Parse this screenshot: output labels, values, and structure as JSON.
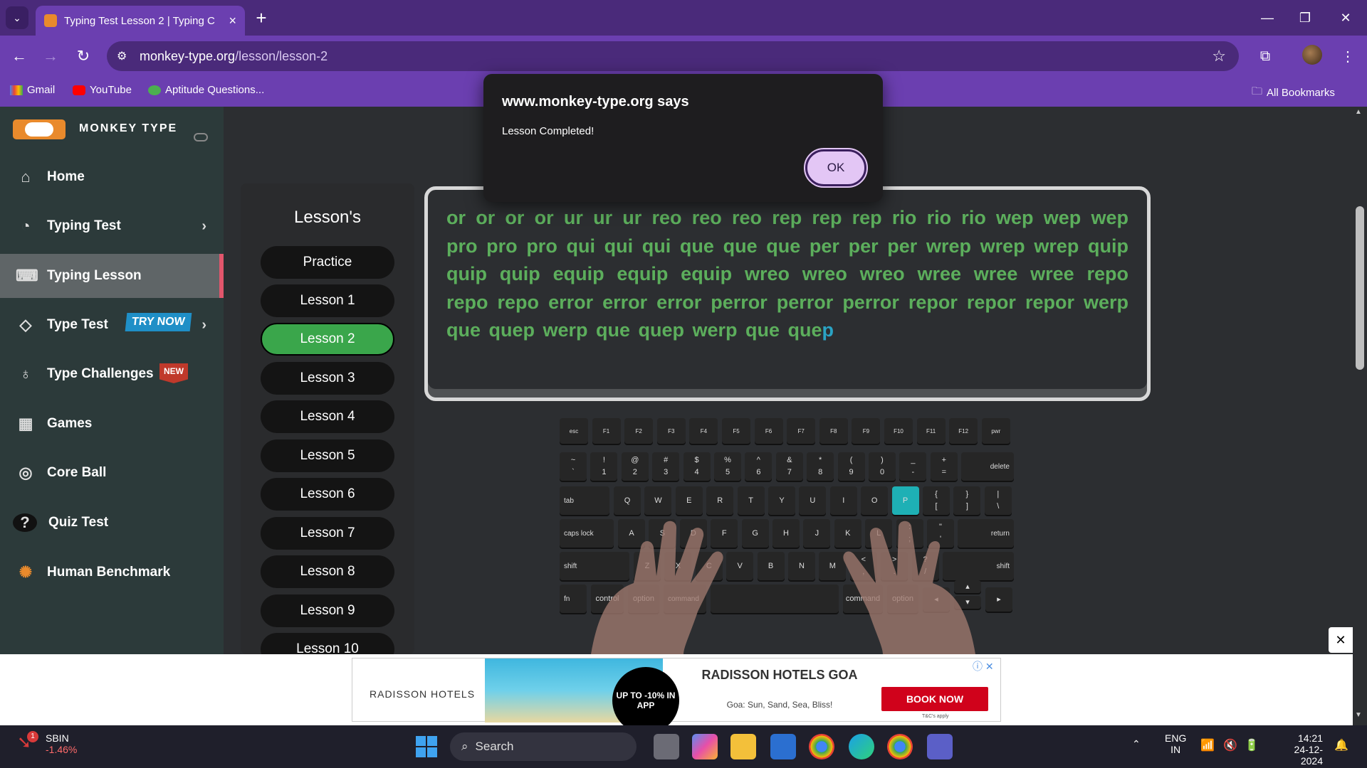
{
  "browser": {
    "tab_title": "Typing Test Lesson 2 | Typing C",
    "url_host": "monkey-type.org",
    "url_path": "/lesson/lesson-2",
    "bookmarks": [
      "Gmail",
      "YouTube",
      "Aptitude Questions..."
    ],
    "all_bookmarks": "All Bookmarks"
  },
  "sidebar": {
    "brand": "MONKEY TYPE",
    "items": [
      {
        "label": "Home",
        "icon": "home-icon"
      },
      {
        "label": "Typing Test",
        "icon": "github-icon"
      },
      {
        "label": "Typing Lesson",
        "icon": "keyboard-icon"
      },
      {
        "label": "Type Test",
        "icon": "gitlab-icon",
        "badge": "TRY NOW"
      },
      {
        "label": "Type Challenges",
        "icon": "award-icon",
        "badge": "NEW"
      },
      {
        "label": "Games",
        "icon": "grid-icon"
      },
      {
        "label": "Core Ball",
        "icon": "target-icon"
      },
      {
        "label": "Quiz Test",
        "icon": "quiz-icon"
      },
      {
        "label": "Human Benchmark",
        "icon": "brain-icon"
      }
    ]
  },
  "lessons": {
    "title": "Lesson's",
    "items": [
      "Practice",
      "Lesson 1",
      "Lesson 2",
      "Lesson 3",
      "Lesson 4",
      "Lesson 5",
      "Lesson 6",
      "Lesson 7",
      "Lesson 8",
      "Lesson 9",
      "Lesson 10"
    ],
    "active": "Lesson 2"
  },
  "typing": {
    "typed_text": "or or or or ur ur ur reo reo reo rep rep rep rio rio rio wep wep wep pro pro pro qui qui qui que que que per per per wrep wrep wrep quip quip quip equip equip equip wreo wreo wreo wree wree wree repo repo repo error error error perror perror perror repor repor repor werp que quep werp que quep werp que que",
    "cursor_char": "p"
  },
  "keyboard": {
    "fn_row": [
      "esc",
      "F1",
      "F2",
      "F3",
      "F4",
      "F5",
      "F6",
      "F7",
      "F8",
      "F9",
      "F10",
      "F11",
      "F12",
      "pwr"
    ],
    "num_row": [
      [
        "~",
        "`"
      ],
      [
        "!",
        "1"
      ],
      [
        "@",
        "2"
      ],
      [
        "#",
        "3"
      ],
      [
        "$",
        "4"
      ],
      [
        "%",
        "5"
      ],
      [
        "^",
        "6"
      ],
      [
        "&",
        "7"
      ],
      [
        "*",
        "8"
      ],
      [
        "(",
        "9"
      ],
      [
        ")",
        "0"
      ],
      [
        "_",
        "-"
      ],
      [
        "+",
        "="
      ]
    ],
    "delete": "delete",
    "tab": "tab",
    "q_row": [
      "Q",
      "W",
      "E",
      "R",
      "T",
      "Y",
      "U",
      "I",
      "O",
      "P"
    ],
    "q_row_brackets": [
      [
        "{",
        "["
      ],
      [
        "}",
        "]"
      ],
      [
        "|",
        "\\"
      ]
    ],
    "caps": "caps lock",
    "a_row": [
      "A",
      "S",
      "D",
      "F",
      "G",
      "H",
      "J",
      "K",
      "L"
    ],
    "a_row_punct": [
      [
        ":",
        ";"
      ],
      [
        "\"",
        "'"
      ]
    ],
    "return": "return",
    "shift": "shift",
    "z_row": [
      "Z",
      "X",
      "C",
      "V",
      "B",
      "N",
      "M"
    ],
    "z_row_punct": [
      [
        "<",
        ","
      ],
      [
        ">",
        "."
      ],
      [
        "?",
        "/"
      ]
    ],
    "bottom_row": [
      "fn",
      "control",
      "option",
      "command",
      "command",
      "option"
    ],
    "highlight": "P"
  },
  "dialog": {
    "title": "www.monkey-type.org says",
    "message": "Lesson Completed!",
    "ok": "OK"
  },
  "ad": {
    "brand": "RADISSON HOTELS",
    "circle": "UP TO -10% IN APP",
    "headline": "RADISSON HOTELS GOA",
    "sub": "Goa: Sun, Sand, Sea, Bliss!",
    "cta": "BOOK NOW",
    "tc": "T&C's apply"
  },
  "taskbar": {
    "stock_name": "SBIN",
    "stock_change": "-1.46%",
    "notif_count": "1",
    "search": "Search",
    "lang": "ENG",
    "region": "IN",
    "time": "14:21",
    "date": "24-12-2024"
  },
  "colors": {
    "accent_purple": "#6b3fb0",
    "typed_green": "#5cae5c",
    "active_lesson": "#3aa64b",
    "highlight_key": "#1eb0b5"
  }
}
